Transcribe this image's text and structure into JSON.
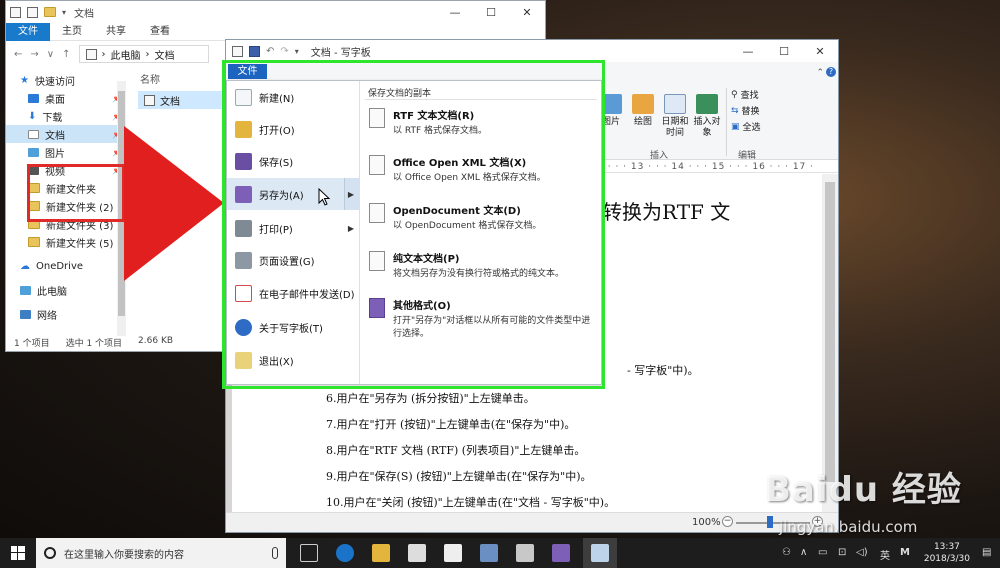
{
  "explorer": {
    "title": "文档",
    "tabs": [
      "文件",
      "主页",
      "共享",
      "查看"
    ],
    "breadcrumb": [
      "此电脑",
      "文档"
    ],
    "nav_items": [
      {
        "label": "快速访问",
        "pinned": false
      },
      {
        "label": "桌面",
        "pinned": true
      },
      {
        "label": "下载",
        "pinned": true
      },
      {
        "label": "文档",
        "pinned": true
      },
      {
        "label": "图片",
        "pinned": true
      },
      {
        "label": "视频",
        "pinned": true
      },
      {
        "label": "新建文件夹",
        "pinned": false
      },
      {
        "label": "新建文件夹 (2)",
        "pinned": false
      },
      {
        "label": "新建文件夹 (3)",
        "pinned": false
      },
      {
        "label": "新建文件夹 (5)",
        "pinned": false
      },
      {
        "label": "OneDrive",
        "pinned": false
      },
      {
        "label": "此电脑",
        "pinned": false
      },
      {
        "label": "网络",
        "pinned": false
      }
    ],
    "column_header": "名称",
    "file_item": "文档",
    "status": {
      "count": "1 个项目",
      "selected": "选中 1 个项目",
      "size": "2.66 KB"
    }
  },
  "wordpad": {
    "title": "文档 - 写字板",
    "file_tab": "文件",
    "ribbon_items": [
      "图片",
      "绘图",
      "日期和时间",
      "插入对象"
    ],
    "ribbon_groups": [
      "插入",
      "编辑"
    ],
    "edit_items": [
      "查找",
      "替换",
      "全选"
    ],
    "ruler_text": "· 12 · · · 13 · · · 14 · · · 15 · · · 16 · · · 17 ·",
    "doc_heading_fragment": "转换为RTF 文",
    "doc_line_fragment": "- 写字板\"中)。",
    "doc_lines": [
      "6.用户在\"另存为 (拆分按钮)\"上左键单击。",
      "7.用户在\"打开 (按钮)\"上左键单击(在\"保存为\"中)。",
      "8.用户在\"RTF 文档 (RTF) (列表项目)\"上左键单击。",
      "9.用户在\"保存(S) (按钮)\"上左键单击(在\"保存为\"中)。",
      "10.用户在\"关闭 (按钮)\"上左键单击(在\"文档 - 写字板\"中)。"
    ],
    "zoom": "100%",
    "zoom_minus": "−",
    "zoom_plus": "+"
  },
  "file_menu": {
    "items": [
      {
        "label": "新建(N)",
        "icon": "new-document-icon",
        "color": "#f4f6f9",
        "submenu": false
      },
      {
        "label": "打开(O)",
        "icon": "open-folder-icon",
        "color": "#e4b53c",
        "submenu": false
      },
      {
        "label": "保存(S)",
        "icon": "save-disk-icon",
        "color": "#6a4ea3",
        "submenu": false
      },
      {
        "label": "另存为(A)",
        "icon": "save-as-icon",
        "color": "#7d5fb8",
        "submenu": true
      },
      {
        "label": "打印(P)",
        "icon": "printer-icon",
        "color": "#7f8a94",
        "submenu": true
      },
      {
        "label": "页面设置(G)",
        "icon": "page-setup-icon",
        "color": "#8d98a4",
        "submenu": false
      },
      {
        "label": "在电子邮件中发送(D)",
        "icon": "email-icon",
        "color": "#d24b4b",
        "submenu": false
      },
      {
        "label": "关于写字板(T)",
        "icon": "info-icon",
        "color": "#2d6bc4",
        "submenu": false
      },
      {
        "label": "退出(X)",
        "icon": "exit-icon",
        "color": "#e9d27a",
        "submenu": false
      }
    ],
    "selected_index": 3,
    "submenu_title": "保存文档的副本",
    "submenu_items": [
      {
        "title": "RTF 文本文档(R)",
        "desc": "以 RTF 格式保存文档。"
      },
      {
        "title": "Office Open XML 文档(X)",
        "desc": "以 Office Open XML 格式保存文档。"
      },
      {
        "title": "OpenDocument 文本(D)",
        "desc": "以 OpenDocument 格式保存文档。"
      },
      {
        "title": "纯文本文档(P)",
        "desc": "将文档另存为没有换行符或格式的纯文本。"
      },
      {
        "title": "其他格式(O)",
        "desc": "打开\"另存为\"对话框以从所有可能的文件类型中进行选择。"
      }
    ]
  },
  "watermark": {
    "brand": "Baidu 经验",
    "site": "jingyan.baidu.com"
  },
  "taskbar": {
    "search_placeholder": "在这里输入你要搜索的内容",
    "ime": "英",
    "ime2": "M",
    "time": "13:37",
    "date": "2018/3/30"
  },
  "colors": {
    "highlight_green": "#2ee52e",
    "highlight_red": "#e02a2a",
    "accent_blue": "#1979ca"
  }
}
